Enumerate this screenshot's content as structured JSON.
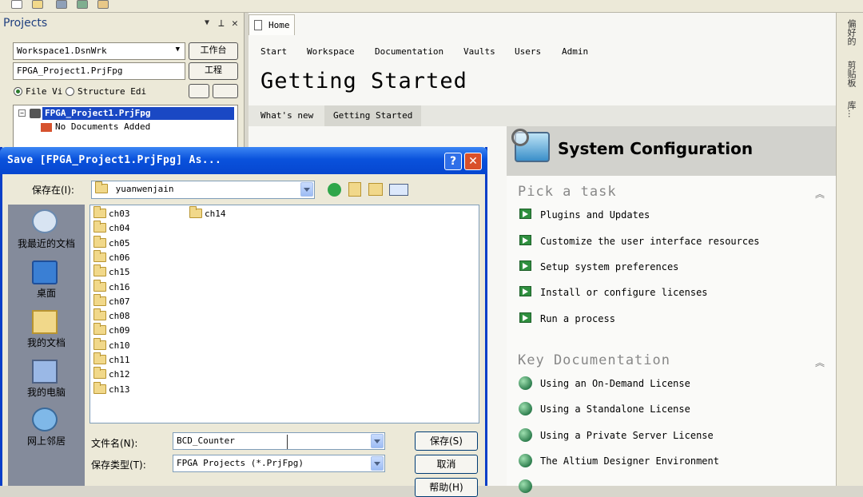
{
  "projects": {
    "title": "Projects",
    "controls": [
      "▼",
      "⊥",
      "✕"
    ],
    "workspace_value": "Workspace1.DsnWrk",
    "workspace_button": "工作台",
    "project_value": "FPGA_Project1.PrjFpg",
    "project_button": "工程",
    "view_file": "File Vi",
    "view_structure": "Structure Edi",
    "tree_project": "FPGA_Project1.PrjFpg",
    "tree_no_docs": "No Documents Added"
  },
  "home_tab": "Home",
  "nav_tabs": [
    "Start",
    "Workspace",
    "Documentation",
    "Vaults",
    "Users",
    "Admin"
  ],
  "heading": "Getting Started",
  "sub_tabs": [
    "What's new",
    "Getting Started"
  ],
  "system_config": {
    "title": "System Configuration",
    "pick_task_title": "Pick a task",
    "tasks": [
      "Plugins and Updates",
      "Customize the user interface resources",
      "Setup system preferences",
      "Install or configure licenses",
      "Run a process"
    ],
    "key_docs_title": "Key Documentation",
    "docs": [
      "Using an On-Demand License",
      "Using a Standalone License",
      "Using a Private Server License",
      "The Altium Designer Environment"
    ]
  },
  "right_panels": [
    "偏好的",
    "剪贴板",
    "库..."
  ],
  "dialog": {
    "title": "Save [FPGA_Project1.PrjFpg] As...",
    "help_glyph": "?",
    "close_glyph": "✕",
    "save_in_label": "保存在(I):",
    "save_in_value": "yuanwenjain",
    "places": [
      "我最近的文档",
      "桌面",
      "我的文档",
      "我的电脑",
      "网上邻居"
    ],
    "folders_col1": [
      "ch03",
      "ch04",
      "ch05",
      "ch06",
      "ch15",
      "ch16",
      "ch07",
      "ch08",
      "ch09",
      "ch10",
      "ch11",
      "ch12",
      "ch13"
    ],
    "folders_col2": [
      "ch14"
    ],
    "filename_label": "文件名(N):",
    "filename_value": "BCD_Counter",
    "filetype_label": "保存类型(T):",
    "filetype_value": "FPGA Projects (*.PrjFpg)",
    "save_button": "保存(S)",
    "cancel_button": "取消",
    "help_button": "帮助(H)"
  },
  "colors": {
    "accent": "#0a52dc",
    "task_arrow": "#2f8f3f"
  }
}
